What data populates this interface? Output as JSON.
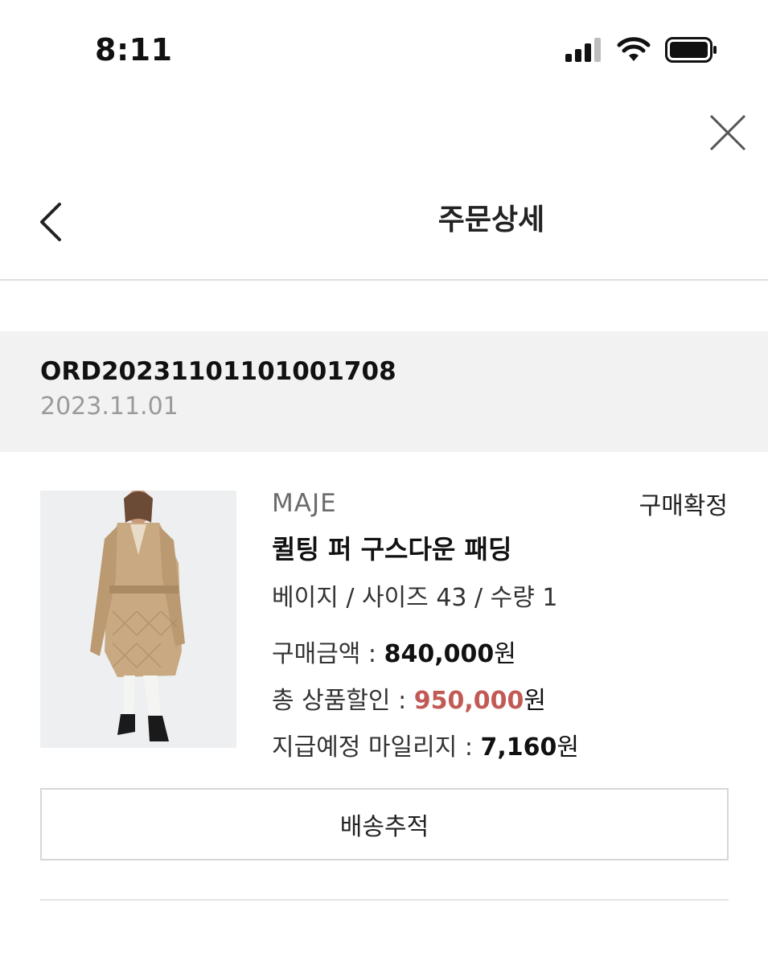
{
  "status_bar": {
    "time": "8:11"
  },
  "header": {
    "title": "주문상세"
  },
  "order": {
    "number": "ORD20231101101001708",
    "date": "2023.11.01"
  },
  "product": {
    "brand": "MAJE",
    "status": "구매확정",
    "name": "퀼팅 퍼 구스다운 패딩",
    "options": "베이지 / 사이즈 43 / 수량 1",
    "purchase_label": "구매금액 : ",
    "purchase_value": "840,000",
    "discount_label": "총 상품할인 : ",
    "discount_value": "950,000",
    "mileage_label": "지급예정 마일리지 : ",
    "mileage_value": "7,160",
    "currency": "원"
  },
  "actions": {
    "track_label": "배송추적"
  },
  "colors": {
    "discount": "#c15a55",
    "band_bg": "#f2f2f2",
    "date_gray": "#9a9a9a"
  },
  "icons": [
    "signal-icon",
    "wifi-icon",
    "battery-icon",
    "close-icon",
    "back-chevron-icon"
  ]
}
